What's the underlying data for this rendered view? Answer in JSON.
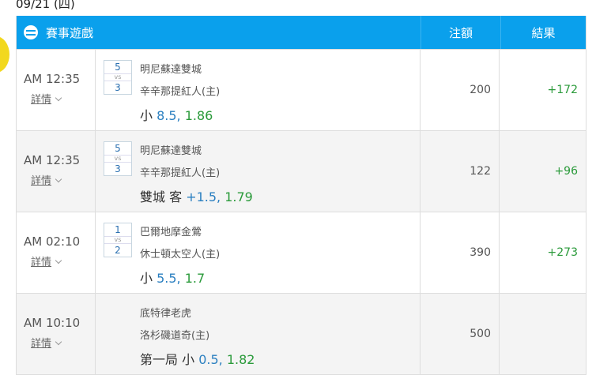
{
  "date_heading": "09/21 (四)",
  "header": {
    "game_label": "賽事遊戲",
    "stake_label": "注額",
    "result_label": "結果"
  },
  "rows": [
    {
      "time": "AM 12:35",
      "detail": "詳情",
      "score_home": "5",
      "score_vs": "vs",
      "score_away": "3",
      "team1": "明尼蘇達雙城",
      "team2": "辛辛那提紅人(主)",
      "bet_prefix": "小 ",
      "bet_num": "8.5, ",
      "bet_odds": "1.86",
      "stake": "200",
      "result": "+172"
    },
    {
      "time": "AM 12:35",
      "detail": "詳情",
      "score_home": "5",
      "score_vs": "vs",
      "score_away": "3",
      "team1": "明尼蘇達雙城",
      "team2": "辛辛那提紅人(主)",
      "bet_prefix": "雙城 客 ",
      "bet_num": "+1.5, ",
      "bet_odds": "1.79",
      "stake": "122",
      "result": "+96"
    },
    {
      "time": "AM 02:10",
      "detail": "詳情",
      "score_home": "1",
      "score_vs": "vs",
      "score_away": "2",
      "team1": "巴爾地摩金鶯",
      "team2": "休士頓太空人(主)",
      "bet_prefix": "小 ",
      "bet_num": "5.5, ",
      "bet_odds": "1.7",
      "stake": "390",
      "result": "+273"
    },
    {
      "time": "AM 10:10",
      "detail": "詳情",
      "team1": "底特律老虎",
      "team2": "洛杉磯道奇(主)",
      "bet_prefix": "第一局 小 ",
      "bet_num": "0.5, ",
      "bet_odds": "1.82",
      "stake": "500",
      "result": ""
    }
  ]
}
